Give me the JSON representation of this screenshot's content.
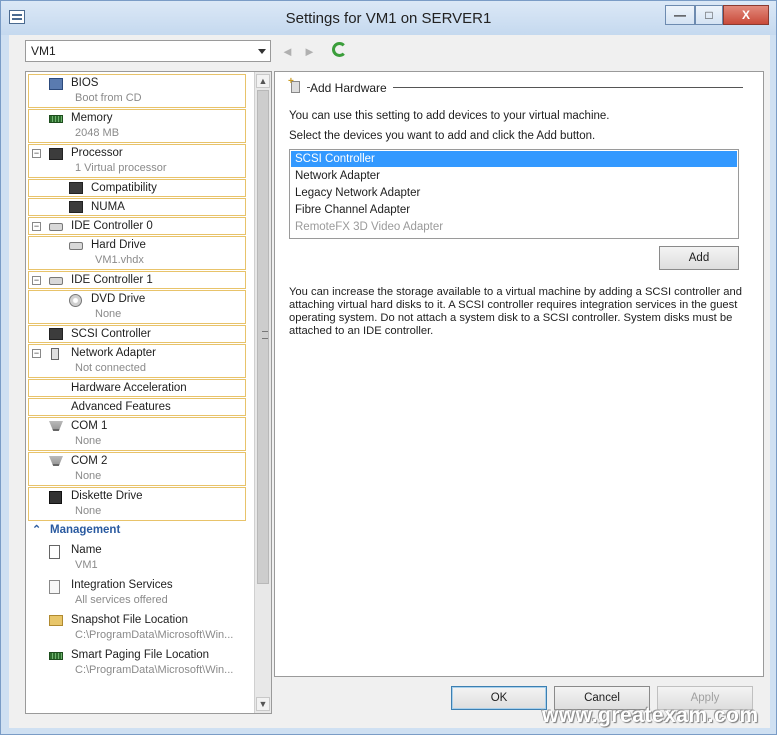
{
  "window": {
    "title": "Settings for VM1 on SERVER1",
    "minimize": "—",
    "maximize": "□",
    "close": "X"
  },
  "vm_selector": {
    "value": "VM1"
  },
  "nav": {
    "back_icon": "◄",
    "forward_icon": "►"
  },
  "tree": {
    "bios": {
      "label": "BIOS",
      "sub": "Boot from CD"
    },
    "memory": {
      "label": "Memory",
      "sub": "2048 MB"
    },
    "processor": {
      "label": "Processor",
      "sub": "1 Virtual processor",
      "expander": "−"
    },
    "compatibility": {
      "label": "Compatibility"
    },
    "numa": {
      "label": "NUMA"
    },
    "ide0": {
      "label": "IDE Controller 0",
      "expander": "−"
    },
    "hard_drive": {
      "label": "Hard Drive",
      "sub": "VM1.vhdx"
    },
    "ide1": {
      "label": "IDE Controller 1",
      "expander": "−"
    },
    "dvd": {
      "label": "DVD Drive",
      "sub": "None"
    },
    "scsi": {
      "label": "SCSI Controller"
    },
    "network": {
      "label": "Network Adapter",
      "sub": "Not connected",
      "expander": "−"
    },
    "hw_accel": {
      "label": "Hardware Acceleration"
    },
    "adv_features": {
      "label": "Advanced Features"
    },
    "com1": {
      "label": "COM 1",
      "sub": "None"
    },
    "com2": {
      "label": "COM 2",
      "sub": "None"
    },
    "diskette": {
      "label": "Diskette Drive",
      "sub": "None"
    },
    "management": {
      "label": "Management",
      "chevron": "⌃"
    },
    "name": {
      "label": "Name",
      "sub": "VM1"
    },
    "integration": {
      "label": "Integration Services",
      "sub": "All services offered"
    },
    "snapshot": {
      "label": "Snapshot File Location",
      "sub": "C:\\ProgramData\\Microsoft\\Win..."
    },
    "paging": {
      "label": "Smart Paging File Location",
      "sub": "C:\\ProgramData\\Microsoft\\Win..."
    }
  },
  "scrollbar": {
    "up": "▲",
    "down": "▼"
  },
  "add_hardware": {
    "title": "Add Hardware",
    "intro": "You can use this setting to add devices to your virtual machine.",
    "instruction": "Select the devices you want to add and click the Add button.",
    "devices": [
      {
        "label": "SCSI Controller"
      },
      {
        "label": "Network Adapter"
      },
      {
        "label": "Legacy Network Adapter"
      },
      {
        "label": "Fibre Channel Adapter"
      },
      {
        "label": "RemoteFX 3D Video Adapter"
      }
    ],
    "selected_device": "SCSI Controller",
    "disabled_device": "RemoteFX 3D Video Adapter",
    "add_button": "Add",
    "description": "You can increase the storage available to a virtual machine by adding a SCSI controller and attaching virtual hard disks to it. A SCSI controller requires integration services in the guest operating system. Do not attach a system disk to a SCSI controller. System disks must be attached to an IDE controller."
  },
  "footer": {
    "ok": "OK",
    "cancel": "Cancel",
    "apply": "Apply"
  },
  "watermark": "www.greatexam.com",
  "colors": {
    "highlight_border": "#e8c36a",
    "selection": "#3399ff",
    "management": "#2a5aa0"
  }
}
